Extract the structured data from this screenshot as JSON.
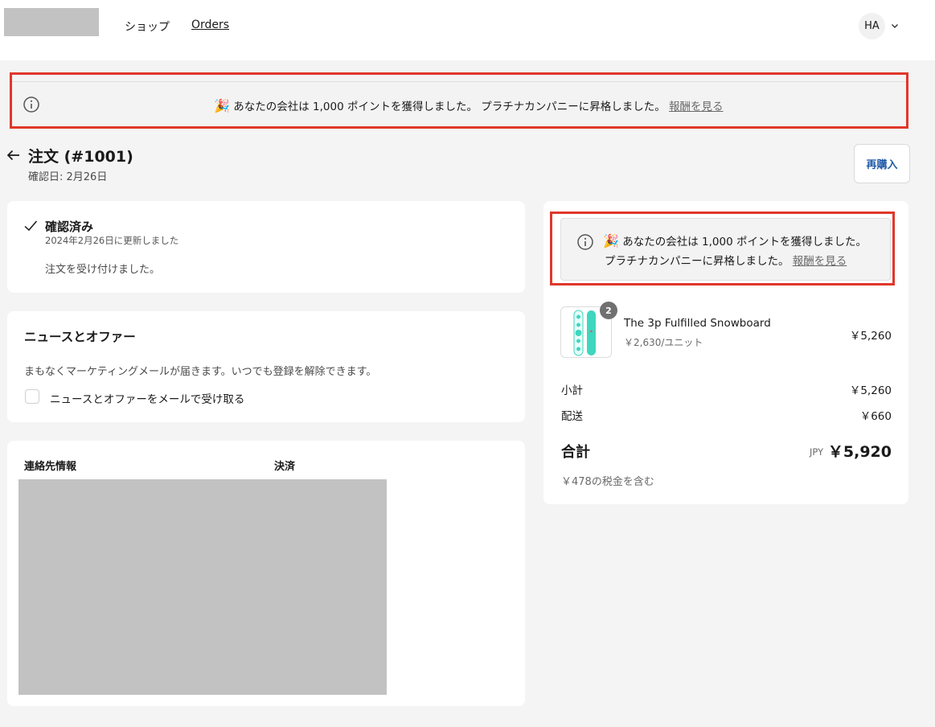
{
  "header": {
    "nav": {
      "shop": "ショップ",
      "orders": "Orders"
    },
    "avatar_initials": "HA"
  },
  "banner": {
    "emoji": "🎉",
    "message": "あなたの会社は 1,000 ポイントを獲得しました。 プラチナカンパニーに昇格しました。",
    "side_line1": "あなたの会社は 1,000 ポイントを獲得しました。",
    "side_line2": "プラチナカンパニーに昇格しました。",
    "link": "報酬を見る"
  },
  "order": {
    "title": "注文 (#1001)",
    "confirmed_date": "確認日: 2月26日",
    "rebuy_label": "再購入"
  },
  "status": {
    "title": "確認済み",
    "updated": "2024年2月26日に更新しました",
    "message": "注文を受け付けました。"
  },
  "news": {
    "title": "ニュースとオファー",
    "description": "まもなくマーケティングメールが届きます。いつでも登録を解除できます。",
    "checkbox_label": "ニュースとオファーをメールで受け取る",
    "checked": false
  },
  "contact": {
    "contact_label": "連絡先情報",
    "payment_label": "決済"
  },
  "summary": {
    "item": {
      "name": "The 3p Fulfilled Snowboard",
      "unit_price": "￥2,630/ユニット",
      "price": "￥5,260",
      "quantity": "2"
    },
    "subtotal_label": "小計",
    "subtotal": "￥5,260",
    "shipping_label": "配送",
    "shipping": "￥660",
    "total_label": "合計",
    "currency": "JPY",
    "total": "￥5,920",
    "tax_note": "￥478の税金を含む"
  },
  "colors": {
    "highlight_outline": "#e0372b",
    "link_blue": "#1f5aa8",
    "snowboard_teal": "#3fd6c0"
  },
  "icons": [
    "info-icon",
    "back-arrow-icon",
    "check-icon",
    "chevron-down-icon"
  ]
}
